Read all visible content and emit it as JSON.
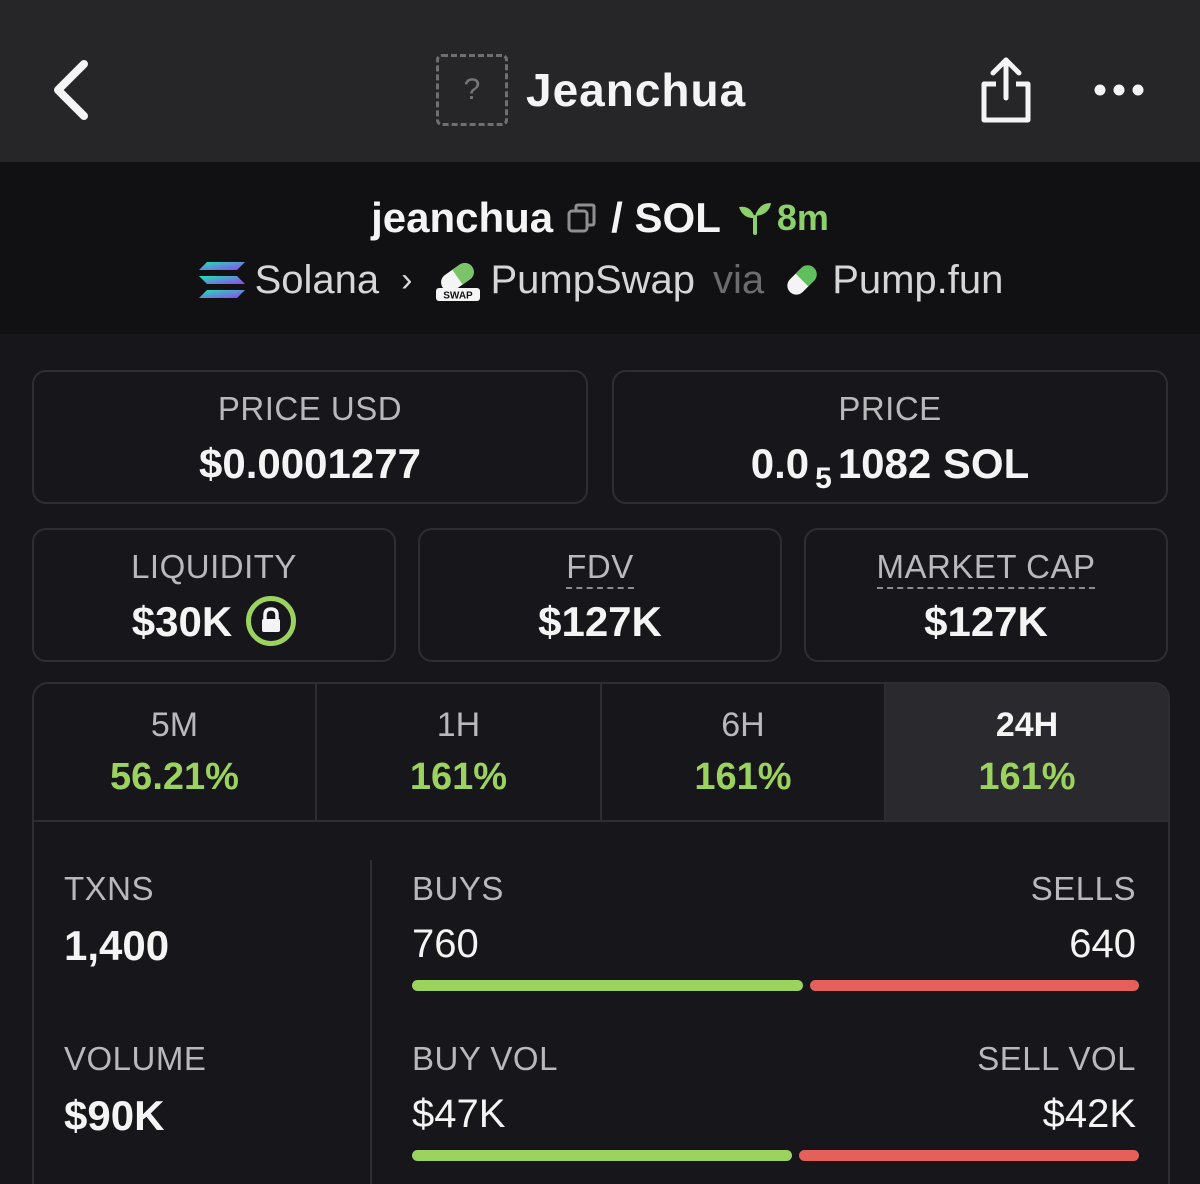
{
  "header": {
    "title": "Jeanchua",
    "token_placeholder": "?",
    "icons": {
      "back": "chevron-left-icon",
      "share": "share-icon",
      "more": "more-horizontal-icon"
    }
  },
  "pair": {
    "base": "jeanchua",
    "separator": "/ SOL",
    "age": "8m",
    "chain": "Solana",
    "dex": "PumpSwap",
    "via_label": "via",
    "launchpad": "Pump.fun",
    "dex_badge_text": "SWAP",
    "icons": {
      "copy": "copy-icon",
      "age": "sprout-icon",
      "chain": "solana-logo-icon",
      "dex": "pumpswap-pill-icon",
      "launchpad": "pill-icon"
    }
  },
  "stats": {
    "price_usd": {
      "label": "PRICE USD",
      "value": "$0.0001277"
    },
    "price": {
      "label": "PRICE",
      "prefix": "0.0",
      "zeros": "5",
      "suffix": "1082 SOL"
    },
    "liquidity": {
      "label": "LIQUIDITY",
      "value": "$30K"
    },
    "fdv": {
      "label": "FDV",
      "value": "$127K"
    },
    "market_cap": {
      "label": "MARKET CAP",
      "value": "$127K"
    }
  },
  "timeframes": [
    {
      "label": "5M",
      "change": "56.21%"
    },
    {
      "label": "1H",
      "change": "161%"
    },
    {
      "label": "6H",
      "change": "161%"
    },
    {
      "label": "24H",
      "change": "161%",
      "active": true
    }
  ],
  "activity": {
    "txns_label": "TXNS",
    "txns": "1,400",
    "volume_label": "VOLUME",
    "volume": "$90K",
    "buys_label": "BUYS",
    "buys": "760",
    "sells_label": "SELLS",
    "sells": "640",
    "buy_vol_label": "BUY VOL",
    "buy_vol": "$47K",
    "sell_vol_label": "SELL VOL",
    "sell_vol": "$42K",
    "buy_share_txns": 0.543,
    "buy_share_volume": 0.528
  },
  "colors": {
    "positive": "#9cd35f",
    "negative": "#e5605a",
    "accent_age": "#8bd06a"
  }
}
